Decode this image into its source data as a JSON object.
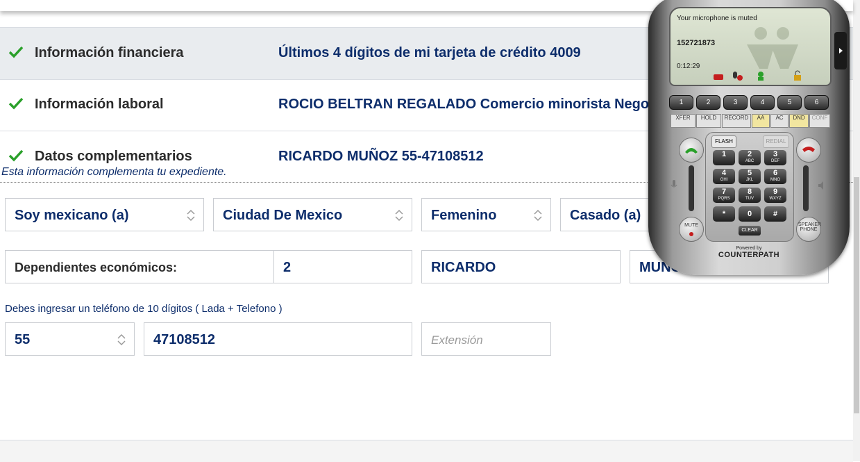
{
  "summary": [
    {
      "label": "Información financiera",
      "value": "Últimos 4 dígitos de mi tarjeta de crédito 4009"
    },
    {
      "label": "Información laboral",
      "value": "ROCIO BELTRAN REGALADO Comercio minorista Negocio"
    },
    {
      "label": "Datos complementarios",
      "value": "RICARDO MUÑOZ 55-47108512"
    }
  ],
  "note": "Esta información complementa tu expediente.",
  "selects": {
    "nationality": "Soy mexicano (a)",
    "city": "Ciudad De Mexico",
    "gender": "Femenino",
    "marital": "Casado (a)"
  },
  "dependents": {
    "label": "Dependientes económicos:",
    "value": "2",
    "first_name": "RICARDO",
    "last_name": "MUÑOZ"
  },
  "phone_hint": "Debes ingresar un teléfono de 10 dígitos ( Lada + Telefono )",
  "phone_fields": {
    "lada": "55",
    "number": "47108512",
    "extension_placeholder": "Extensión"
  },
  "softphone": {
    "status": "Your microphone is muted",
    "number": "152721873",
    "timer": "0:12:29",
    "line_buttons": [
      "1",
      "2",
      "3",
      "4",
      "5",
      "6"
    ],
    "function_buttons": [
      "XFER",
      "HOLD",
      "RECORD",
      "AA",
      "AC",
      "DND",
      "CONF"
    ],
    "flash": "FLASH",
    "redial": "REDIAL",
    "keys": [
      {
        "d": "1",
        "l": ""
      },
      {
        "d": "2",
        "l": "ABC"
      },
      {
        "d": "3",
        "l": "DEF"
      },
      {
        "d": "4",
        "l": "GHI"
      },
      {
        "d": "5",
        "l": "JKL"
      },
      {
        "d": "6",
        "l": "MNO"
      },
      {
        "d": "7",
        "l": "PQRS"
      },
      {
        "d": "8",
        "l": "TUV"
      },
      {
        "d": "9",
        "l": "WXYZ"
      },
      {
        "d": "*",
        "l": ""
      },
      {
        "d": "0",
        "l": ""
      },
      {
        "d": "#",
        "l": ""
      }
    ],
    "clear": "CLEAR",
    "mute": "MUTE",
    "speaker": "SPEAKER PHONE",
    "powered_by": "Powered by",
    "brand": "COUNTERPATH",
    "colors": {
      "accent_green": "#2aa02a",
      "hangup_red": "#c41e1e"
    }
  }
}
